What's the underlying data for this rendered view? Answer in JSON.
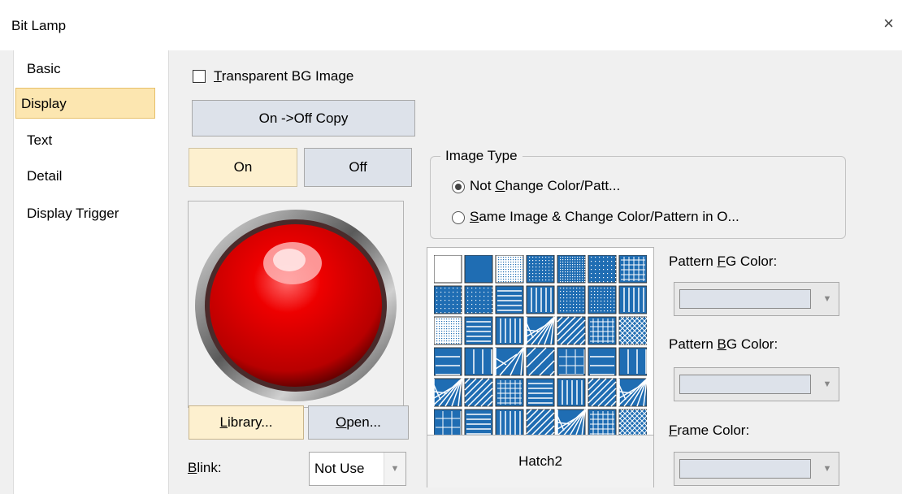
{
  "window": {
    "title": "Bit Lamp",
    "close_symbol": "×"
  },
  "sidebar": {
    "items": [
      {
        "label": "Basic",
        "active": false
      },
      {
        "label": "Display",
        "active": true
      },
      {
        "label": "Text",
        "active": false
      },
      {
        "label": "Detail",
        "active": false
      },
      {
        "label": "Display Trigger",
        "active": false
      }
    ]
  },
  "display": {
    "transparent_bg": {
      "mnemonic": "T",
      "rest": "ransparent BG Image",
      "checked": false
    },
    "copy_button": "On ->Off Copy",
    "state_tabs": {
      "on": "On",
      "off": "Off",
      "selected": "On"
    },
    "library_button": {
      "mnemonic": "L",
      "rest": "ibrary..."
    },
    "open_button": {
      "mnemonic": "O",
      "rest": "pen..."
    },
    "blink": {
      "mnemonic": "B",
      "rest": "link:",
      "value": "Not Use"
    },
    "image_type": {
      "title": "Image Type",
      "options": [
        {
          "pre": "Not ",
          "mnemonic": "C",
          "rest": "hange Color/Patt...",
          "selected": true
        },
        {
          "pre": "",
          "mnemonic": "S",
          "rest": "ame Image & Change Color/Pattern in O...",
          "selected": false
        }
      ]
    },
    "pattern": {
      "selected_name": "Hatch2",
      "fill_color": "#1f6db3"
    },
    "pattern_fg": {
      "pre": "Pattern ",
      "mnemonic": "F",
      "rest": "G Color:"
    },
    "pattern_bg": {
      "pre": "Pattern ",
      "mnemonic": "B",
      "rest": "G Color:"
    },
    "frame_color": {
      "pre": "",
      "mnemonic": "F",
      "rest": "rame Color:"
    },
    "colors": {
      "active_tab": "#fdf0cf",
      "button_face": "#dde2ea",
      "lamp_red": "#e00000"
    }
  }
}
